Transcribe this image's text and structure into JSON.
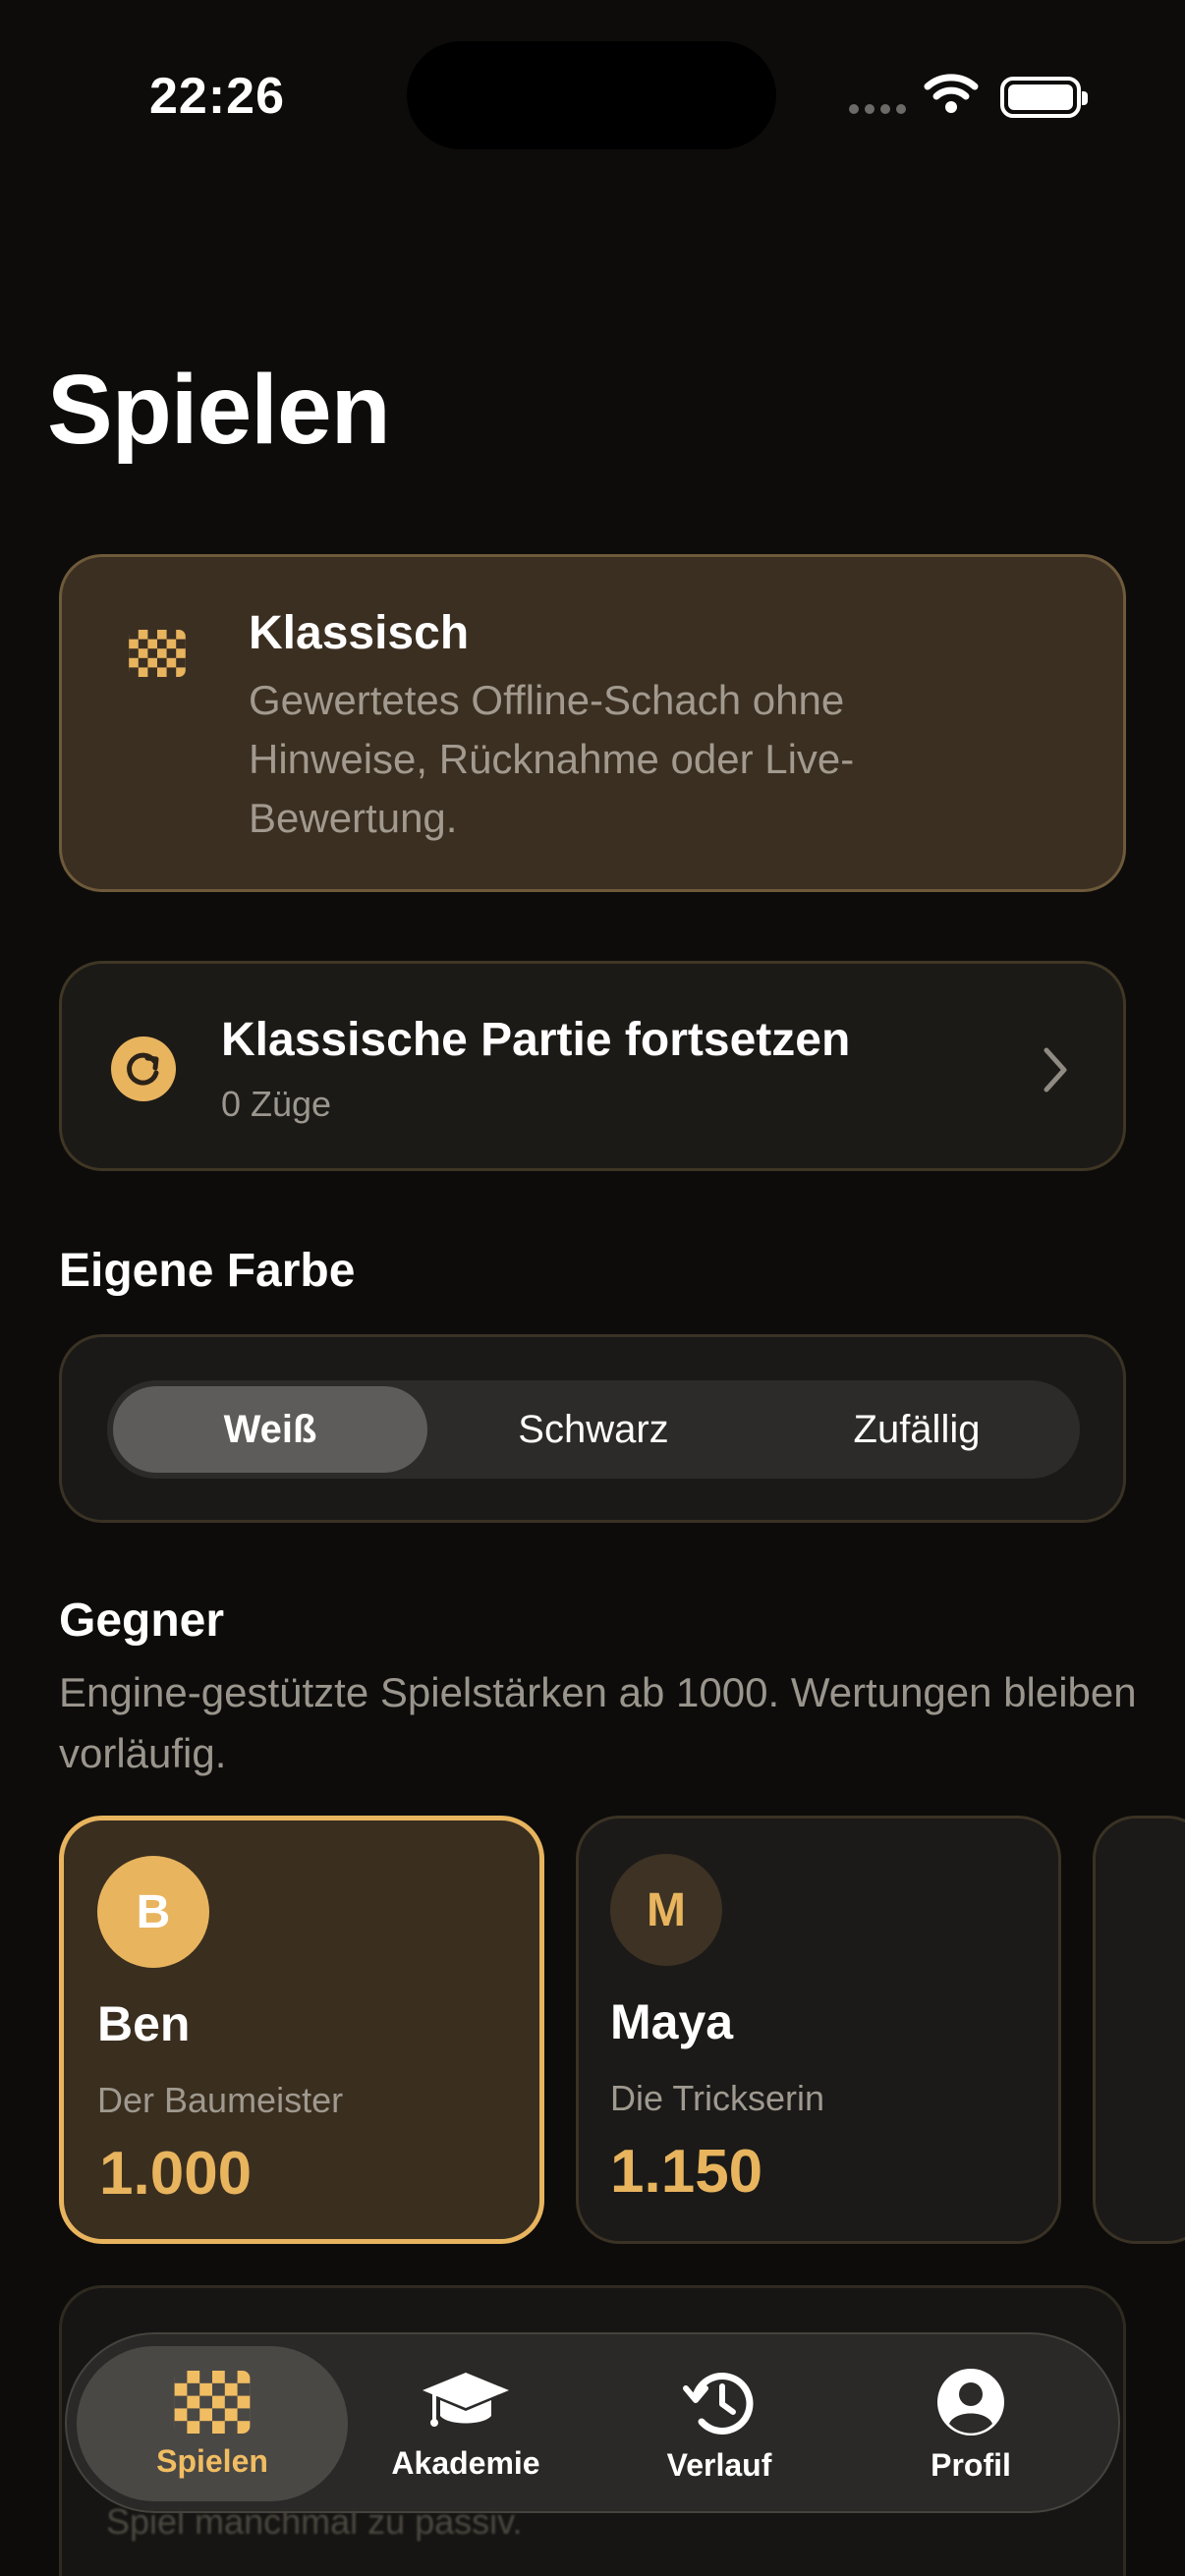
{
  "status_bar": {
    "time": "22:26"
  },
  "page": {
    "title": "Spielen"
  },
  "mode_card": {
    "icon": "chessboard-icon",
    "title": "Klassisch",
    "description": "Gewertetes Offline-Schach ohne Hinweise, Rücknahme oder Live-Bewertung."
  },
  "resume_card": {
    "icon": "resume-icon",
    "title": "Klassische Partie fortsetzen",
    "subtitle": "0 Züge"
  },
  "color_section": {
    "title": "Eigene Farbe",
    "options": [
      "Weiß",
      "Schwarz",
      "Zufällig"
    ],
    "selected": "Weiß"
  },
  "opponents_section": {
    "title": "Gegner",
    "description": "Engine-gestützte Spielstärken ab 1000. Wertungen bleiben vorläufig.",
    "opponents": [
      {
        "initial": "B",
        "name": "Ben",
        "title": "Der Baumeister",
        "rating": "1.000",
        "selected": true
      },
      {
        "initial": "M",
        "name": "Maya",
        "title": "Die Trickserin",
        "rating": "1.150",
        "selected": false
      }
    ]
  },
  "hidden_card": {
    "text": "Spiel manchmal zu passiv."
  },
  "tab_bar": {
    "tabs": [
      {
        "label": "Spielen",
        "icon": "chessboard-icon",
        "active": true
      },
      {
        "label": "Akademie",
        "icon": "graduation-cap-icon",
        "active": false
      },
      {
        "label": "Verlauf",
        "icon": "history-icon",
        "active": false
      },
      {
        "label": "Profil",
        "icon": "profile-icon",
        "active": false
      }
    ]
  },
  "colors": {
    "accent": "#e8b45e",
    "background": "#0d0c0b",
    "card": "#1c1a17",
    "selected_card": "#3b2f22"
  }
}
